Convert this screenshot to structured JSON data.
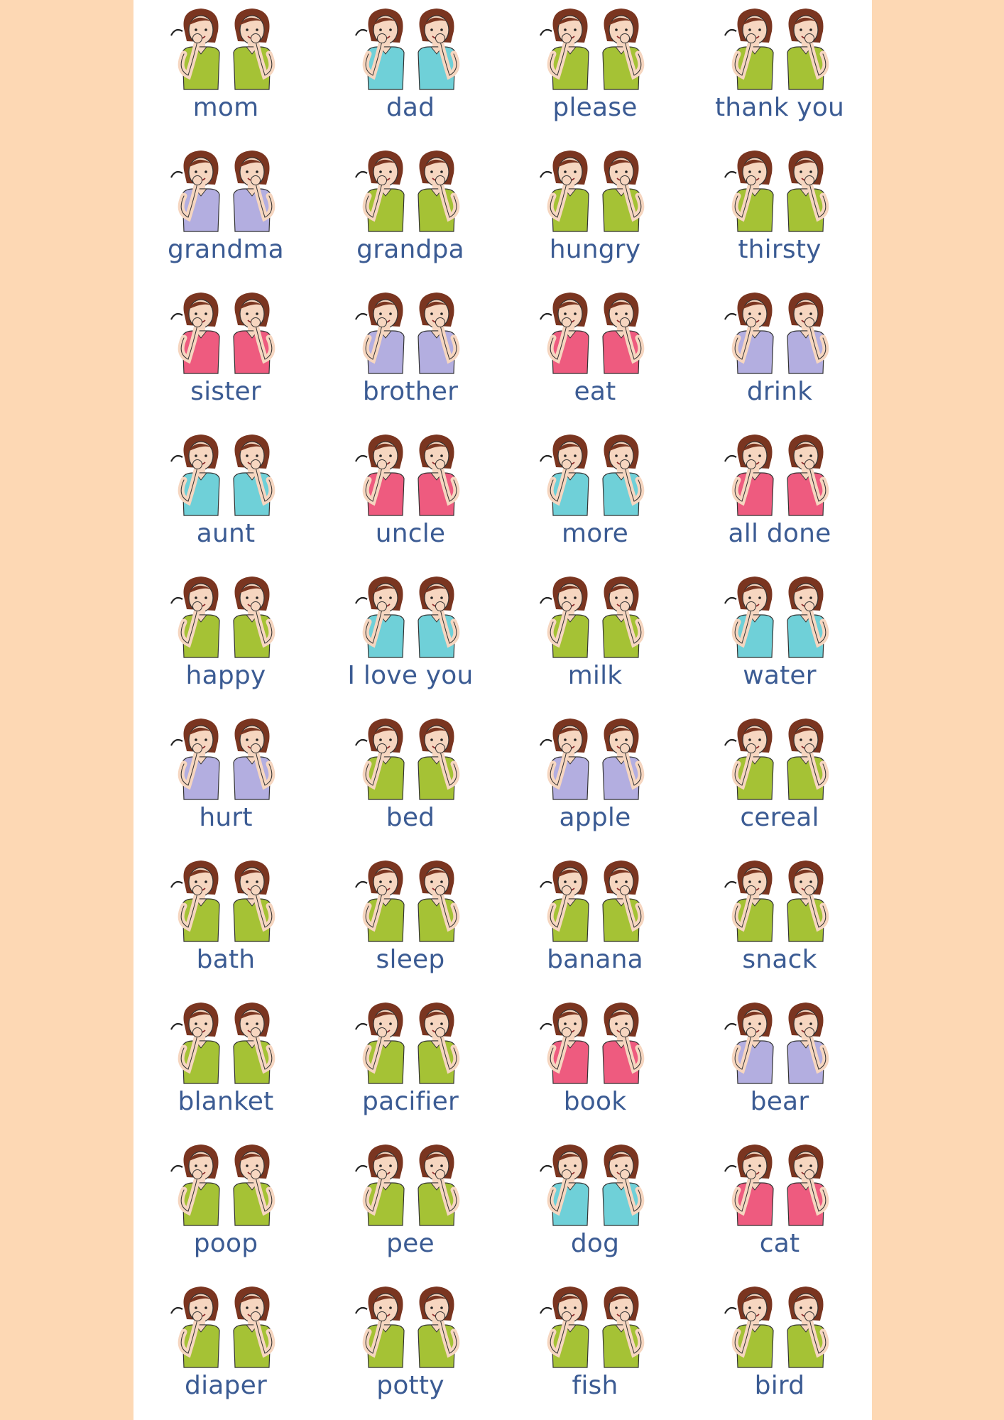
{
  "signs": [
    {
      "label": "mom",
      "shirt": "#a5c235"
    },
    {
      "label": "dad",
      "shirt": "#6fd0d8"
    },
    {
      "label": "please",
      "shirt": "#a5c235"
    },
    {
      "label": "thank you",
      "shirt": "#a5c235"
    },
    {
      "label": "grandma",
      "shirt": "#b3aee0"
    },
    {
      "label": "grandpa",
      "shirt": "#a5c235"
    },
    {
      "label": "hungry",
      "shirt": "#a5c235"
    },
    {
      "label": "thirsty",
      "shirt": "#a5c235"
    },
    {
      "label": "sister",
      "shirt": "#ee5b7f"
    },
    {
      "label": "brother",
      "shirt": "#b3aee0"
    },
    {
      "label": "eat",
      "shirt": "#ee5b7f"
    },
    {
      "label": "drink",
      "shirt": "#b3aee0"
    },
    {
      "label": "aunt",
      "shirt": "#6fd0d8"
    },
    {
      "label": "uncle",
      "shirt": "#ee5b7f"
    },
    {
      "label": "more",
      "shirt": "#6fd0d8"
    },
    {
      "label": "all done",
      "shirt": "#ee5b7f"
    },
    {
      "label": "happy",
      "shirt": "#a5c235"
    },
    {
      "label": "I love you",
      "shirt": "#6fd0d8"
    },
    {
      "label": "milk",
      "shirt": "#a5c235"
    },
    {
      "label": "water",
      "shirt": "#6fd0d8"
    },
    {
      "label": "hurt",
      "shirt": "#b3aee0"
    },
    {
      "label": "bed",
      "shirt": "#a5c235"
    },
    {
      "label": "apple",
      "shirt": "#b3aee0"
    },
    {
      "label": "cereal",
      "shirt": "#a5c235"
    },
    {
      "label": "bath",
      "shirt": "#a5c235"
    },
    {
      "label": "sleep",
      "shirt": "#a5c235"
    },
    {
      "label": "banana",
      "shirt": "#a5c235"
    },
    {
      "label": "snack",
      "shirt": "#a5c235"
    },
    {
      "label": "blanket",
      "shirt": "#a5c235"
    },
    {
      "label": "pacifier",
      "shirt": "#a5c235"
    },
    {
      "label": "book",
      "shirt": "#ee5b7f"
    },
    {
      "label": "bear",
      "shirt": "#b3aee0"
    },
    {
      "label": "poop",
      "shirt": "#a5c235"
    },
    {
      "label": "pee",
      "shirt": "#a5c235"
    },
    {
      "label": "dog",
      "shirt": "#6fd0d8"
    },
    {
      "label": "cat",
      "shirt": "#ee5b7f"
    },
    {
      "label": "diaper",
      "shirt": "#a5c235"
    },
    {
      "label": "potty",
      "shirt": "#a5c235"
    },
    {
      "label": "fish",
      "shirt": "#a5c235"
    },
    {
      "label": "bird",
      "shirt": "#a5c235"
    }
  ],
  "colors": {
    "page_background": "#fdd8b4",
    "card_background": "#ffffff",
    "label_text": "#3b5b93",
    "hair": "#7a3520",
    "skin": "#f6d6c0"
  }
}
